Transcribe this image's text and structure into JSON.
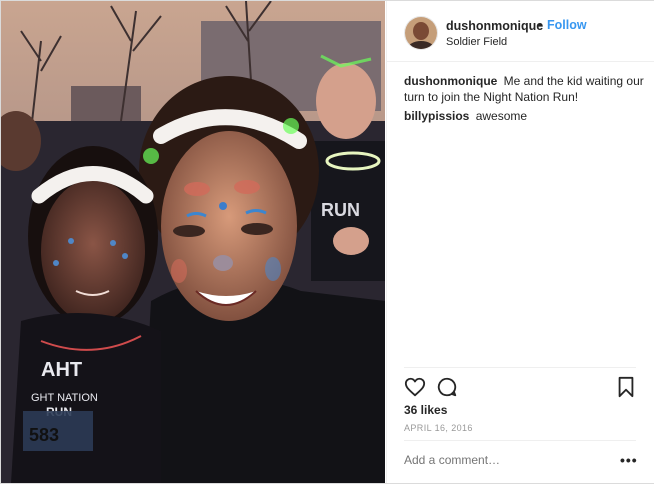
{
  "post": {
    "username": "dushonmonique",
    "follow_label": "Follow",
    "separator": "•",
    "location": "Soldier Field",
    "comments": [
      {
        "username": "dushonmonique",
        "text": "Me and the kid waiting our turn to join the Night Nation Run!"
      },
      {
        "username": "billypissios",
        "text": "awesome"
      }
    ],
    "likes": "36 likes",
    "date": "April 16, 2016",
    "add_comment_placeholder": "Add a comment…",
    "more_label": "•••"
  },
  "colors": {
    "link": "#3897f0",
    "text": "#262626",
    "muted": "#999999",
    "border": "#dbdbdb"
  },
  "icons": [
    "heart-icon",
    "comment-icon",
    "bookmark-icon",
    "more-options-icon"
  ]
}
